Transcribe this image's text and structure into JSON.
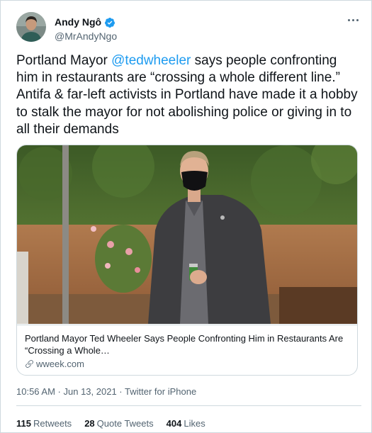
{
  "author": {
    "display_name": "Andy Ngô",
    "handle": "@MrAndyNgo",
    "avatar_icon": "person-avatar",
    "verified_color": "#1d9bf0"
  },
  "tweet": {
    "text_before": "Portland Mayor ",
    "mention": "@tedwheeler",
    "text_after": " says people confronting him in restaurants are “crossing a whole different line.” Antifa & far-left activists in Portland have made it a hobby to stalk the mayor for not abolishing police or giving in to all their demands"
  },
  "card": {
    "title": "Portland Mayor Ted Wheeler Says People Confronting Him in Restaurants Are “Crossing a Whole…",
    "domain": "wweek.com",
    "image_icon": "man-in-mask-photo"
  },
  "meta": {
    "time": "10:56 AM",
    "separator": " · ",
    "date": "Jun 13, 2021",
    "source": "Twitter for iPhone"
  },
  "stats": {
    "retweets_count": "115",
    "retweets_label": "Retweets",
    "quotes_count": "28",
    "quotes_label": "Quote Tweets",
    "likes_count": "404",
    "likes_label": "Likes"
  },
  "colors": {
    "accent": "#1d9bf0",
    "secondary_text": "#536471",
    "border": "#cfd9de"
  }
}
